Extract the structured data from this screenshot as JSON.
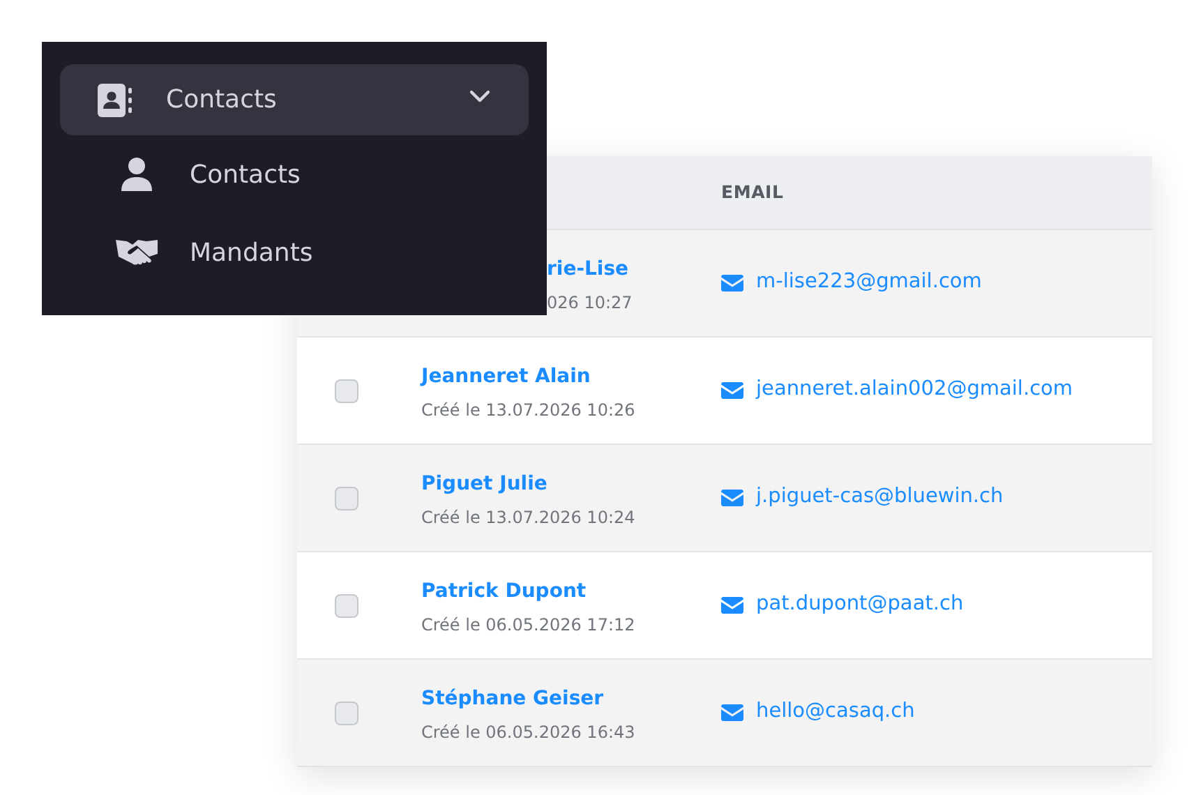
{
  "menu": {
    "label": "Contacts",
    "expanded": true,
    "children": [
      {
        "label": "Contacts",
        "kind": "person"
      },
      {
        "label": "Mandants",
        "kind": "handshake"
      }
    ]
  },
  "table": {
    "columns": [
      "EMAIL"
    ],
    "rows": [
      {
        "name": "rie-Lise",
        "created": "026 10:27",
        "email": "m-lise223@gmail.com",
        "covered": true
      },
      {
        "name": "Jeanneret Alain",
        "created": "Créé le 13.07.2026 10:26",
        "email": "jeanneret.alain002@gmail.com",
        "checked": false,
        "covered": false
      },
      {
        "name": "Piguet Julie",
        "created": "Créé le 13.07.2026 10:24",
        "email": "j.piguet-cas@bluewin.ch",
        "checked": false,
        "covered": false
      },
      {
        "name": "Patrick Dupont",
        "created": "Créé le 06.05.2026 17:12",
        "email": "pat.dupont@paat.ch",
        "checked": false,
        "covered": false
      },
      {
        "name": "Stéphane Geiser",
        "created": "Créé le 06.05.2026 16:43",
        "email": "hello@casaq.ch",
        "checked": false,
        "covered": false
      }
    ]
  }
}
